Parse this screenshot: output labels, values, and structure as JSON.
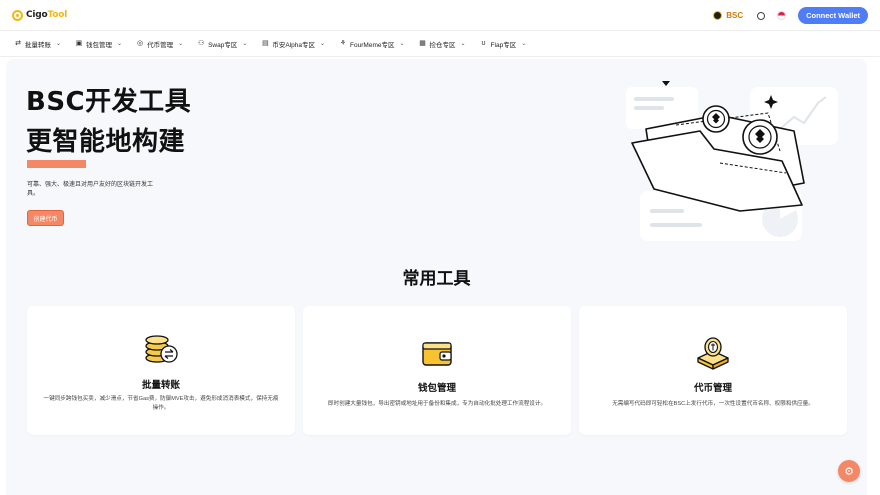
{
  "header": {
    "logo_prefix": "Cigo",
    "logo_suffix": "Tool",
    "logo_mark": "…",
    "chain_label": "BSC",
    "connect_label": "Connect Wallet"
  },
  "nav": {
    "items": [
      {
        "label": "批量转账",
        "icon": "transfer-icon"
      },
      {
        "label": "钱包管理",
        "icon": "wallet-icon"
      },
      {
        "label": "代币管理",
        "icon": "token-icon"
      },
      {
        "label": "Swap专区",
        "icon": "swap-icon"
      },
      {
        "label": "币安Alpha专区",
        "icon": "alpha-icon"
      },
      {
        "label": "FourMeme专区",
        "icon": "fourmeme-icon"
      },
      {
        "label": "捡仓专区",
        "icon": "gift-icon"
      },
      {
        "label": "Flap专区",
        "icon": "flap-icon"
      }
    ]
  },
  "hero": {
    "title_line1": "BSC开发工具",
    "title_line2": "更智能地构建",
    "description": "可靠、强大、极速且对用户友好的区块链开发工具。",
    "cta_label": "创建代币"
  },
  "section": {
    "title": "常用工具"
  },
  "cards": [
    {
      "title": "批量转账",
      "description": "一键同步跨钱包买卖，减少滑点，节省Gas费，防御MVE攻击，避免形成消消表模式，保持无痕操作。",
      "icon": "coins-transfer-icon"
    },
    {
      "title": "钱包管理",
      "description": "即时创建大量钱包，导出密钥或地址用于备份和集成，专为自动化批处理工作流程设计。",
      "icon": "wallet-icon"
    },
    {
      "title": "代币管理",
      "description": "无需编写代码即可轻松在BSC上发行代币，一次性设置代币名称、权限和供应量。",
      "icon": "token-box-icon"
    }
  ],
  "colors": {
    "accent": "#f48766",
    "brand_blue": "#4f7cf7",
    "bnb_yellow": "#f0b90b"
  }
}
